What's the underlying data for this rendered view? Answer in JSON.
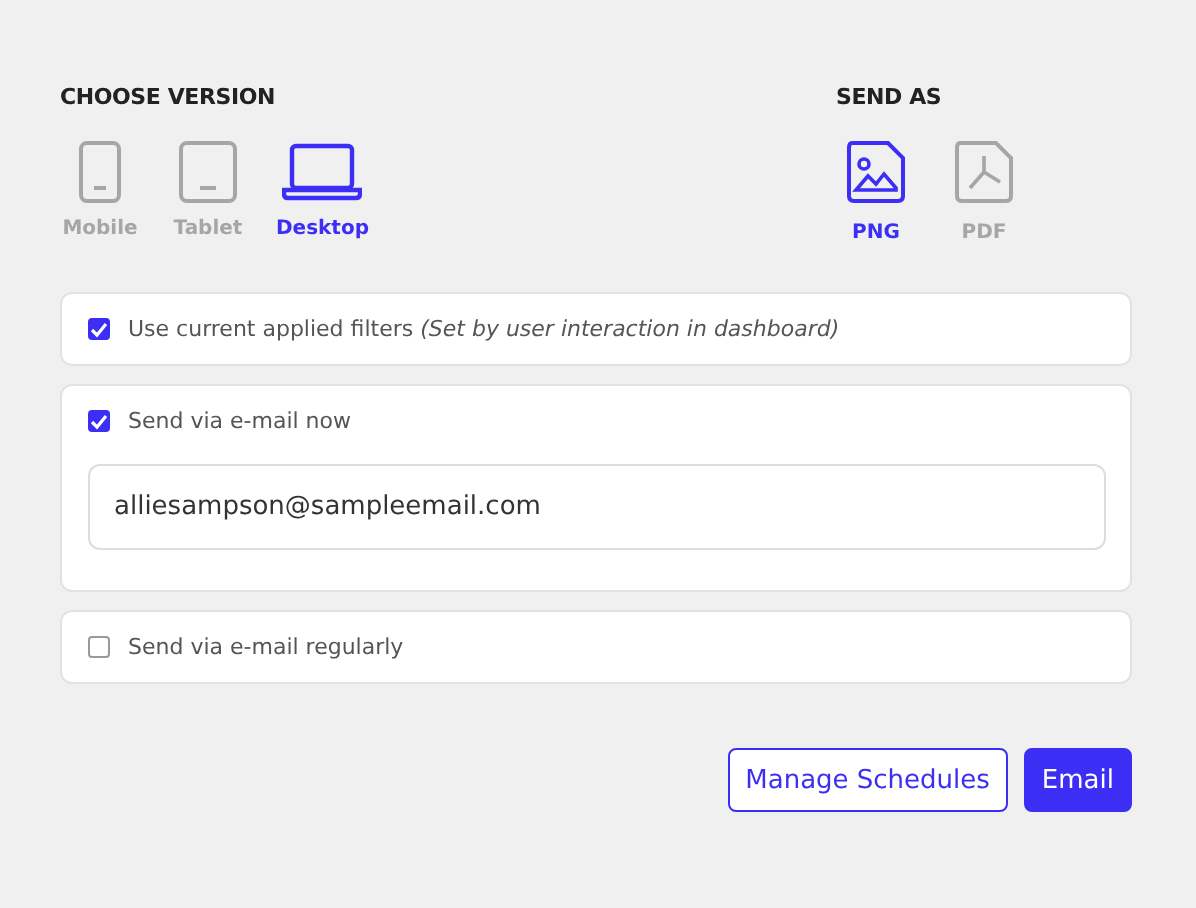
{
  "choose_version": {
    "heading": "CHOOSE VERSION",
    "options": [
      {
        "kind": "mobile",
        "label": "Mobile",
        "selected": false
      },
      {
        "kind": "tablet",
        "label": "Tablet",
        "selected": false
      },
      {
        "kind": "desktop",
        "label": "Desktop",
        "selected": true
      }
    ]
  },
  "send_as": {
    "heading": "SEND AS",
    "options": [
      {
        "kind": "image",
        "label": "PNG",
        "selected": true
      },
      {
        "kind": "pdf",
        "label": "PDF",
        "selected": false
      }
    ]
  },
  "settings": [
    {
      "label": "Use current applied filters *(Set by user interaction in dashboard)*",
      "checked": true
    },
    {
      "label": "Send via e-mail now",
      "checked": true,
      "email": "alliesampson@sampleemail.com"
    },
    {
      "label": "Send via e-mail regularly",
      "checked": false
    }
  ],
  "buttons": [
    {
      "kind": "outline",
      "label": "Manage Schedules"
    },
    {
      "kind": "primary",
      "label": "Email"
    }
  ]
}
